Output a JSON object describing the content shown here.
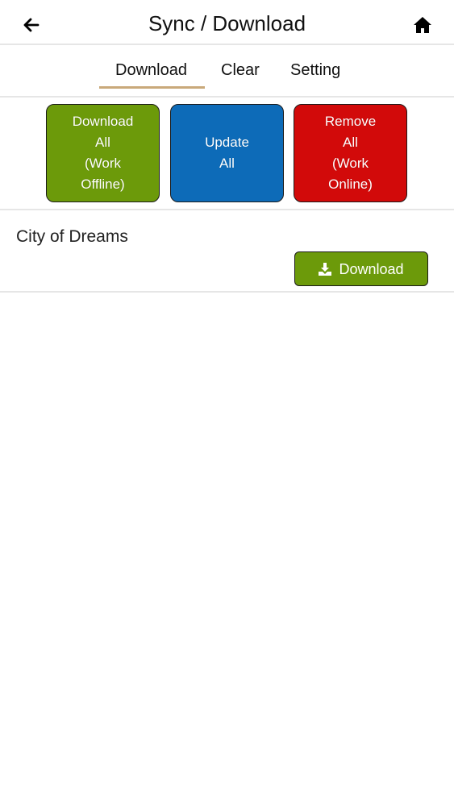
{
  "header": {
    "title": "Sync / Download",
    "back_icon": "arrow-left-icon",
    "home_icon": "home-icon"
  },
  "tabs": [
    {
      "label": "Download",
      "active": true
    },
    {
      "label": "Clear",
      "active": false
    },
    {
      "label": "Setting",
      "active": false
    }
  ],
  "actions": {
    "download_all": {
      "label": "Download\nAll\n(Work\nOffline)",
      "color": "#6c9a0a"
    },
    "update_all": {
      "label": "Update\nAll",
      "color": "#0d6bb8"
    },
    "remove_all": {
      "label": "Remove\nAll\n(Work\nOnline)",
      "color": "#d20a0a"
    }
  },
  "items": [
    {
      "title": "City of Dreams",
      "button_label": "Download",
      "button_icon": "download-icon"
    }
  ],
  "colors": {
    "tab_underline": "#c9a97a",
    "divider": "#e6e6e6"
  }
}
